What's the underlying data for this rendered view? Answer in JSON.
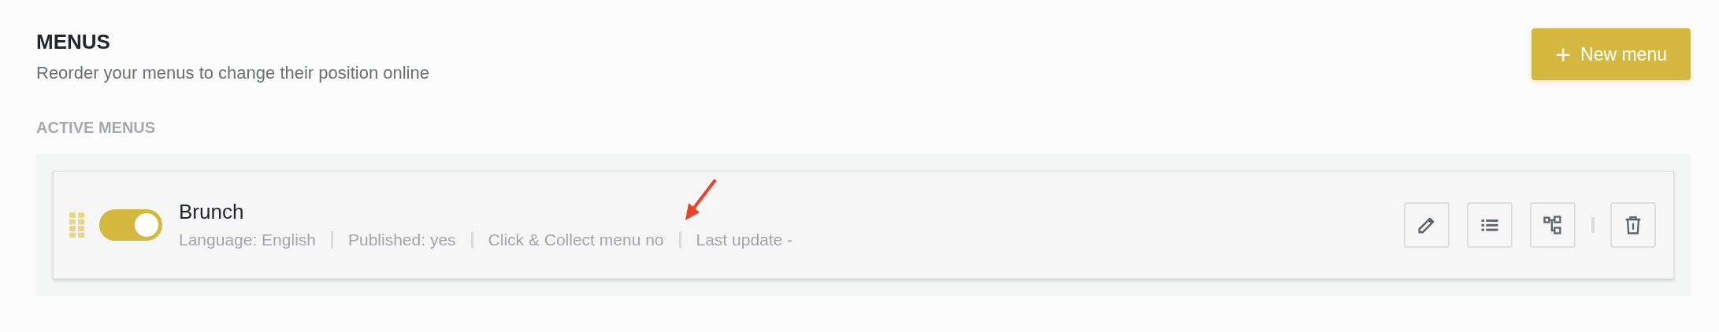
{
  "header": {
    "title": "MENUS",
    "subtitle": "Reorder your menus to change their position online",
    "new_button": {
      "icon": "+",
      "label": "New menu"
    }
  },
  "section_title": "ACTIVE MENUS",
  "menus": [
    {
      "name": "Brunch",
      "on": true,
      "meta": [
        "Language: English",
        "Published: yes",
        "Click & Collect menu no",
        "Last update -"
      ],
      "actions": [
        {
          "kind": "edit"
        },
        {
          "kind": "list"
        },
        {
          "kind": "tree"
        },
        {
          "kind": "delete"
        }
      ]
    }
  ]
}
